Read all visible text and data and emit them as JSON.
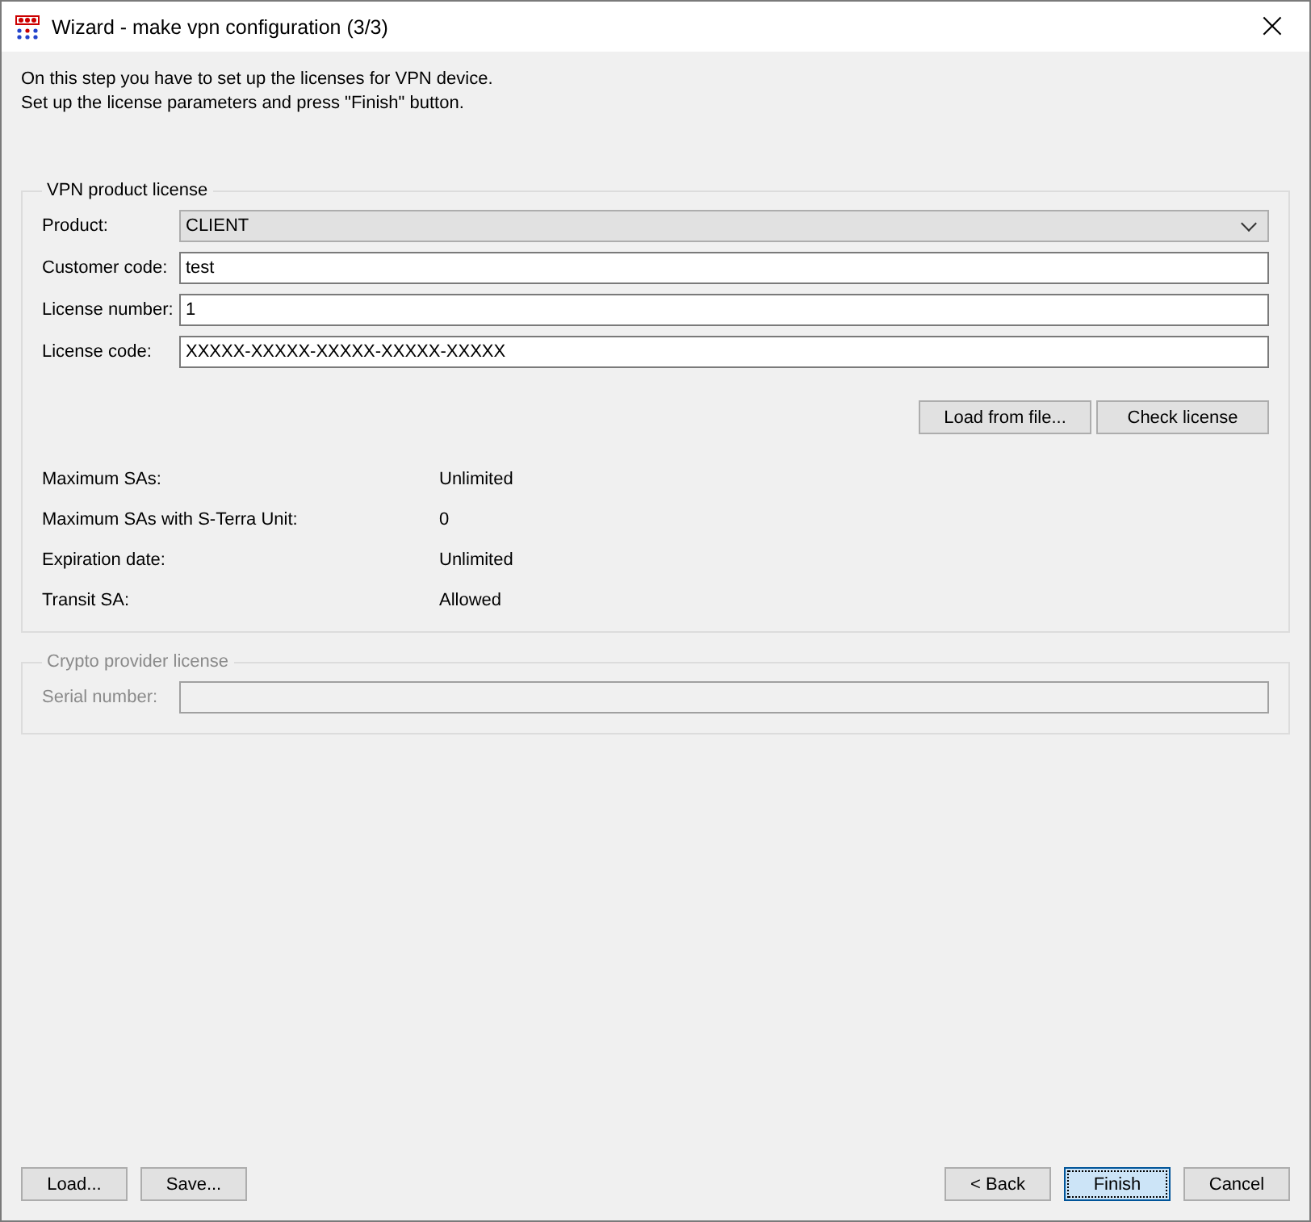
{
  "window": {
    "title": "Wizard - make vpn configuration (3/3)",
    "close": "×"
  },
  "intro": [
    "On this step you have to set up the licenses for VPN device.",
    "Set up the license parameters and press \"Finish\" button."
  ],
  "product_license": {
    "title": "VPN product license",
    "disabled": false,
    "fields": [
      {
        "kind": "dropdown",
        "label": "Product:",
        "value": "CLIENT"
      },
      {
        "kind": "text",
        "label": "Customer code:",
        "value": "test"
      },
      {
        "kind": "text",
        "label": "License number:",
        "value": "1"
      },
      {
        "kind": "text",
        "label": "License code:",
        "value": "XXXXX-XXXXX-XXXXX-XXXXX-XXXXX"
      }
    ],
    "buttons": [
      "Load from file...",
      "Check license"
    ],
    "info": [
      {
        "label": "Maximum SAs:",
        "value": "Unlimited"
      },
      {
        "label": "Maximum SAs with S-Terra Unit:",
        "value": "0"
      },
      {
        "label": "Expiration date:",
        "value": "Unlimited"
      },
      {
        "label": "Transit SA:",
        "value": "Allowed"
      }
    ]
  },
  "crypto_license": {
    "title": "Crypto provider license",
    "disabled": true,
    "fields": [
      {
        "kind": "text",
        "label": "Serial number:"
      }
    ]
  },
  "footer": {
    "left": [
      {
        "label": "Load...",
        "default": false
      },
      {
        "label": "Save...",
        "default": false
      }
    ],
    "right": [
      {
        "label": "< Back",
        "default": false
      },
      {
        "label": "Finish",
        "default": true
      },
      {
        "label": "Cancel",
        "default": false
      }
    ]
  }
}
